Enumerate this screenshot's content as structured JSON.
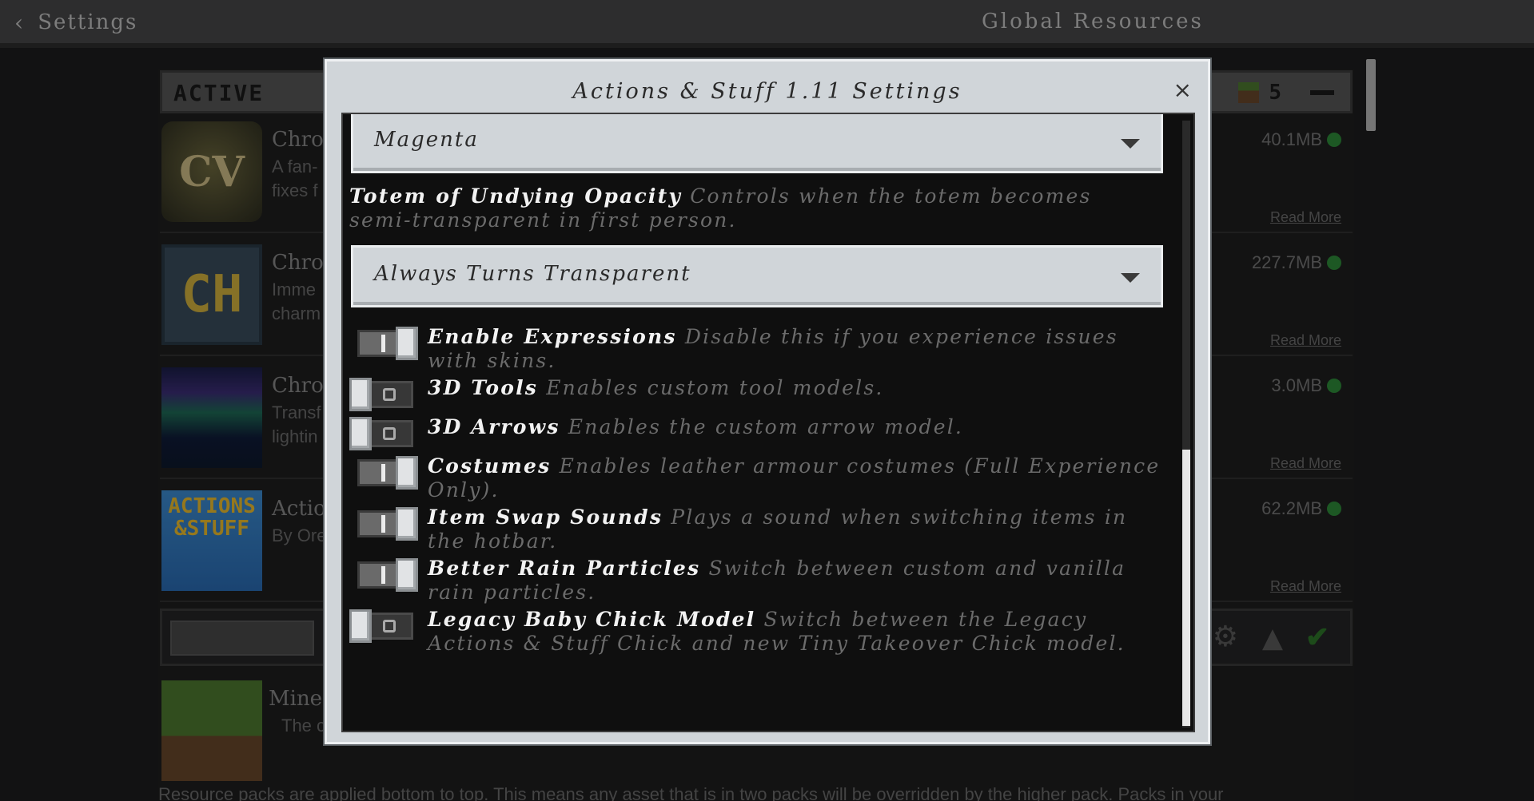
{
  "header": {
    "back_label": "Settings",
    "title": "Global Resources"
  },
  "active_section": {
    "label": "ACTIVE",
    "count": "5"
  },
  "packs": [
    {
      "name": "Chro",
      "desc": "A fan-\nfixes f",
      "size": "40.1MB",
      "read_more": "Read More",
      "icon_text": "CV"
    },
    {
      "name": "Chro",
      "desc": "Imme\ncharm",
      "size": "227.7MB",
      "read_more": "Read More",
      "icon_text": "CH"
    },
    {
      "name": "Chro",
      "desc": "Transf\nlightin",
      "size": "3.0MB",
      "read_more": "Read More",
      "icon_text": ""
    },
    {
      "name": "Actio",
      "desc": "By Ore",
      "size": "62.2MB",
      "read_more": "Read More",
      "icon_text": "ACTIONS\n&STUFF"
    }
  ],
  "mine_pack": {
    "name": "Mine",
    "desc": "The c"
  },
  "bottom_note": "Resource packs are applied bottom to top. This means any asset that is in two packs will be overridden by the higher pack. Packs in your",
  "modal": {
    "title": "Actions & Stuff 1.11 Settings",
    "close_symbol": "×",
    "dropdown_top": "Magenta",
    "totem_label": "Totem of Undying Opacity",
    "totem_desc": "Controls when the totem becomes semi-transparent in first person.",
    "dropdown_totem": "Always Turns Transparent",
    "settings": [
      {
        "label": "Enable Expressions",
        "desc": "Disable this if you experience issues with skins.",
        "state": "on"
      },
      {
        "label": "3D Tools",
        "desc": "Enables custom tool models.",
        "state": "off"
      },
      {
        "label": "3D Arrows",
        "desc": "Enables the custom arrow model.",
        "state": "off"
      },
      {
        "label": "Costumes",
        "desc": "Enables leather armour costumes (Full Experience Only).",
        "state": "on"
      },
      {
        "label": "Item Swap Sounds",
        "desc": "Plays a sound when switching items in the hotbar.",
        "state": "on"
      },
      {
        "label": "Better Rain Particles",
        "desc": "Switch between custom and vanilla rain particles.",
        "state": "on"
      },
      {
        "label": "Legacy Baby Chick Model",
        "desc": "Switch between the Legacy Actions & Stuff Chick and new Tiny Takeover Chick model.",
        "state": "off"
      }
    ]
  },
  "icons": {
    "back": "chevron-left-icon",
    "close": "close-icon",
    "dropdown": "triangle-down-icon",
    "gear": "gear-icon",
    "up": "arrow-up-icon",
    "check": "checkmark-icon"
  },
  "colors": {
    "modal_bg": "#d0d5d9",
    "content_bg": "#0f0f0f",
    "accent_green": "#2f8f3a"
  }
}
